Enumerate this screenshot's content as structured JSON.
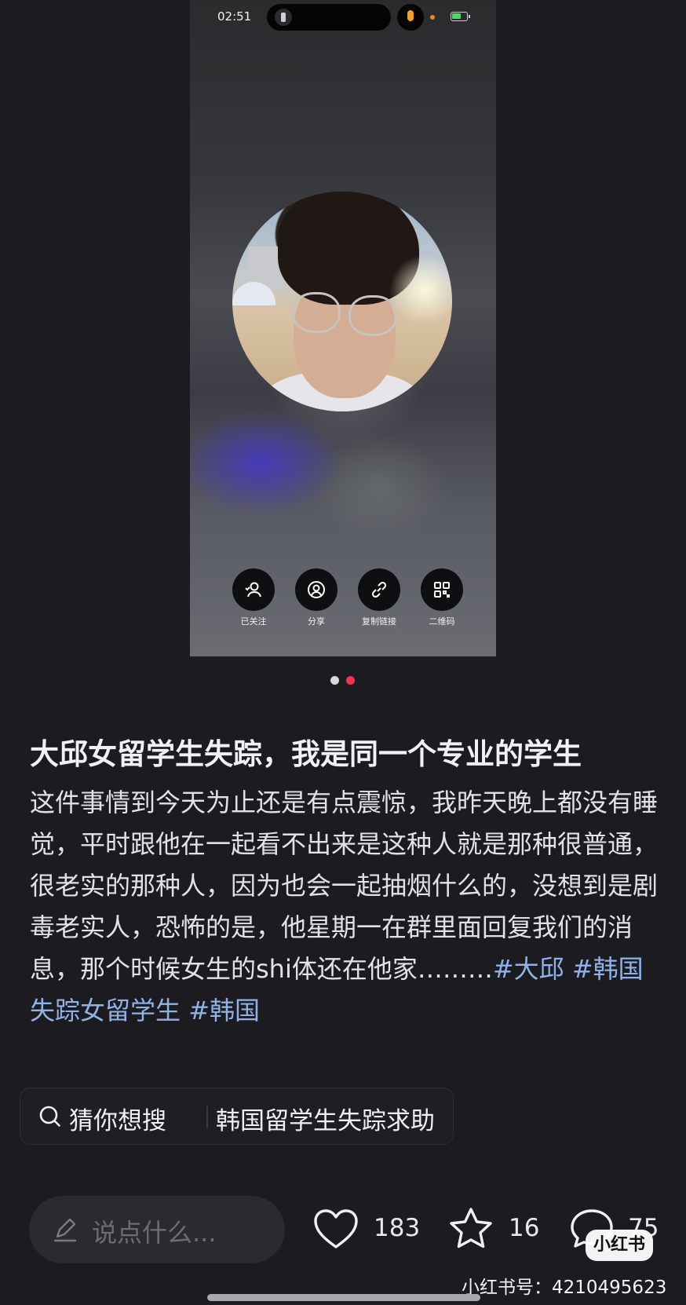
{
  "screenshot": {
    "status_bar": {
      "time": "02:51"
    },
    "profile_actions": [
      {
        "label": "已关注",
        "icon": "followed-user-icon"
      },
      {
        "label": "分享",
        "icon": "share-profile-icon"
      },
      {
        "label": "复制链接",
        "icon": "link-icon"
      },
      {
        "label": "二维码",
        "icon": "qr-code-icon"
      }
    ]
  },
  "pager": {
    "total": 2,
    "active_index": 1,
    "colors": {
      "inactive": "#d8d8dc",
      "active": "#ff2e4d"
    }
  },
  "post": {
    "title": "大邱女留学生失踪，我是同一个专业的学生",
    "body": "这件事情到今天为止还是有点震惊，我昨天晚上都没有睡觉，平时跟他在一起看不出来是这种人就是那种很普通，很老实的那种人，因为也会一起抽烟什么的，没想到是剧毒老实人，恐怖的是，他星期一在群里面回复我们的消息，那个时候女生的shi体还在他家………",
    "tags": [
      "#大邱",
      "#韩国失踪女留学生",
      "#韩国"
    ]
  },
  "search_suggestion": {
    "label": "猜你想搜",
    "term": "韩国留学生失踪求助",
    "icon": "search-icon"
  },
  "bottom_bar": {
    "comment_placeholder": "说点什么...",
    "likes": "183",
    "collects": "16",
    "comments": "75"
  },
  "watermark": {
    "brand": "小红书",
    "account": "小红书号：4210495623"
  },
  "colors": {
    "background": "#1b1b20",
    "tag_link": "#8fb3e8",
    "brand_red": "#ff2e4d"
  }
}
